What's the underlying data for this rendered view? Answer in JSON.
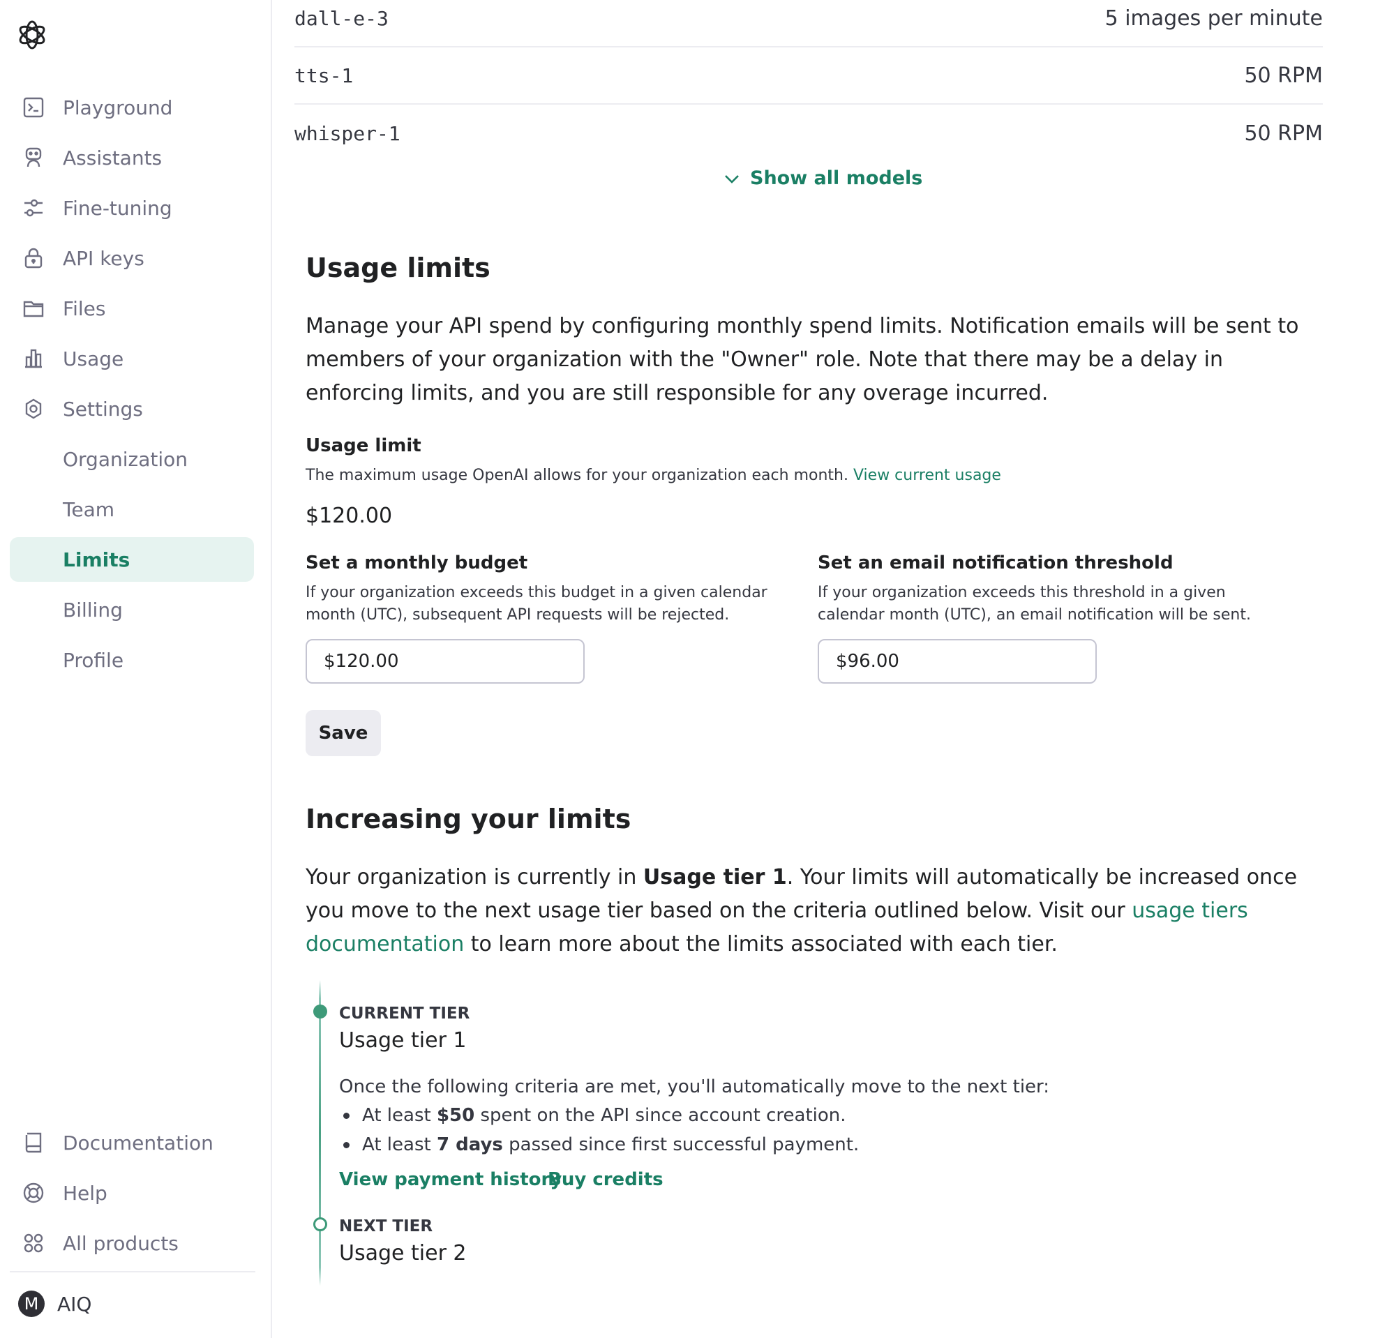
{
  "sidebar": {
    "nav": [
      {
        "label": "Playground",
        "icon": "terminal-icon"
      },
      {
        "label": "Assistants",
        "icon": "robot-icon"
      },
      {
        "label": "Fine-tuning",
        "icon": "sliders-icon"
      },
      {
        "label": "API keys",
        "icon": "lock-icon"
      },
      {
        "label": "Files",
        "icon": "folder-icon"
      },
      {
        "label": "Usage",
        "icon": "bar-chart-icon"
      },
      {
        "label": "Settings",
        "icon": "gear-icon"
      }
    ],
    "settings_sub": [
      {
        "label": "Organization"
      },
      {
        "label": "Team"
      },
      {
        "label": "Limits",
        "active": true
      },
      {
        "label": "Billing"
      },
      {
        "label": "Profile"
      }
    ],
    "bottom": [
      {
        "label": "Documentation",
        "icon": "book-icon"
      },
      {
        "label": "Help",
        "icon": "lifebuoy-icon"
      },
      {
        "label": "All products",
        "icon": "grid-icon"
      }
    ],
    "user": {
      "initial": "M",
      "name": "AIQ"
    }
  },
  "models": [
    {
      "name": "dall-e-3",
      "limit": "5 images per minute"
    },
    {
      "name": "tts-1",
      "limit": "50 RPM"
    },
    {
      "name": "whisper-1",
      "limit": "50 RPM"
    }
  ],
  "show_all_label": "Show all models",
  "usage_limits": {
    "title": "Usage limits",
    "description": "Manage your API spend by configuring monthly spend limits. Notification emails will be sent to members of your organization with the \"Owner\" role. Note that there may be a delay in enforcing limits, and you are still responsible for any overage incurred.",
    "limit_label": "Usage limit",
    "limit_help": "The maximum usage OpenAI allows for your organization each month.",
    "limit_link": "View current usage",
    "limit_amount": "$120.00",
    "budget_label": "Set a monthly budget",
    "budget_help": "If your organization exceeds this budget in a given calendar month (UTC), subsequent API requests will be rejected.",
    "budget_value": "$120.00",
    "threshold_label": "Set an email notification threshold",
    "threshold_help": "If your organization exceeds this threshold in a given calendar month (UTC), an email notification will be sent.",
    "threshold_value": "$96.00",
    "save_label": "Save"
  },
  "increasing": {
    "title": "Increasing your limits",
    "text_before": "Your organization is currently in ",
    "tier_bold": "Usage tier 1",
    "text_after": ". Your limits will automatically be increased once you move to the next usage tier based on the criteria outlined below. Visit our ",
    "docs_link": "usage tiers documentation",
    "text_end": " to learn more about the limits associated with each tier.",
    "current_caption": "CURRENT TIER",
    "current_tier": "Usage tier 1",
    "criteria_intro": "Once the following criteria are met, you'll automatically move to the next tier:",
    "criteria": [
      {
        "pre": "At least ",
        "bold": "$50",
        "post": " spent on the API since account creation."
      },
      {
        "pre": "At least ",
        "bold": "7 days",
        "post": " passed since first successful payment."
      }
    ],
    "payment_history_link": "View payment history",
    "buy_credits_link": "Buy credits",
    "next_caption": "NEXT TIER",
    "next_tier": "Usage tier 2"
  },
  "colors": {
    "accent": "#1a7f64",
    "active_bg": "#e6f3f0",
    "timeline": "#3e9a79"
  }
}
